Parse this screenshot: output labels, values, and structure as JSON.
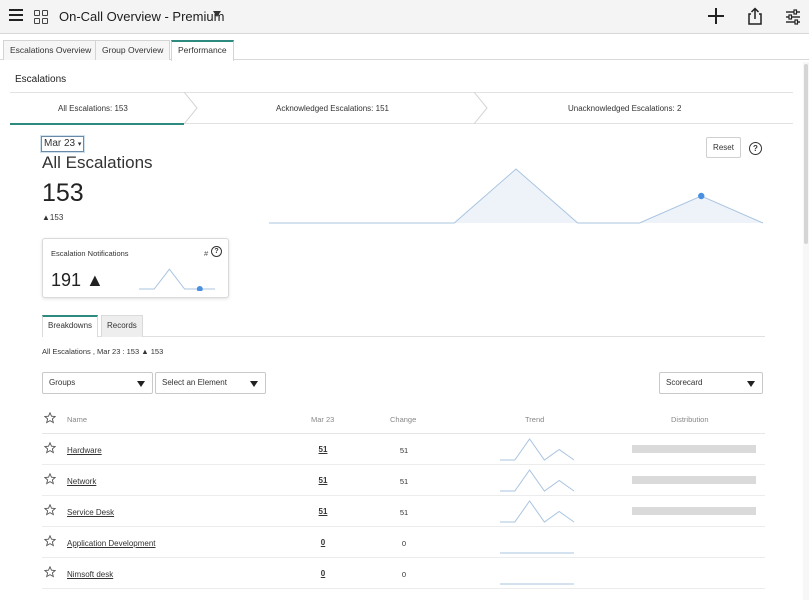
{
  "topbar": {
    "title": "On-Call Overview - Premium",
    "icons": [
      "menu-icon",
      "grid-icon",
      "chevron-down-icon",
      "plus-icon",
      "share-icon",
      "filter-icon"
    ]
  },
  "tabs": [
    {
      "label": "Escalations Overview",
      "active": false
    },
    {
      "label": "Group Overview",
      "active": false
    },
    {
      "label": "Performance",
      "active": true
    }
  ],
  "section": {
    "title": "Escalations",
    "steps": [
      {
        "label": "All Escalations: 153",
        "active": true
      },
      {
        "label": "Acknowledged Escalations: 151",
        "active": false
      },
      {
        "label": "Unacknowledged Escalations: 2",
        "active": false
      }
    ]
  },
  "kpi": {
    "date_select": "Mar 23",
    "title": "All Escalations",
    "value": "153",
    "delta": "▲153",
    "reset_label": "Reset",
    "trend_series": [
      0,
      0,
      0,
      0,
      1,
      0,
      0,
      0.5,
      0
    ]
  },
  "card": {
    "title": "Escalation Notifications",
    "hash": "#",
    "value": "191 ▲",
    "spark_series": [
      0,
      0,
      0.9,
      0,
      0,
      0
    ]
  },
  "subtabs": [
    {
      "label": "Breakdowns",
      "active": true
    },
    {
      "label": "Records",
      "active": false
    }
  ],
  "summary": "All Escalations , Mar 23 : 153 ▲ 153",
  "filters": {
    "groups": "Groups",
    "element": "Select an Element",
    "view": "Scorecard"
  },
  "table": {
    "columns": [
      "Name",
      "Mar 23",
      "Change",
      "Trend",
      "Distribution"
    ],
    "rows": [
      {
        "name": "Hardware",
        "value": "51",
        "change": "51",
        "trend": [
          0,
          0,
          1,
          0,
          0.5,
          0
        ],
        "distribution": 1
      },
      {
        "name": "Network",
        "value": "51",
        "change": "51",
        "trend": [
          0,
          0,
          1,
          0,
          0.5,
          0
        ],
        "distribution": 1
      },
      {
        "name": "Service Desk",
        "value": "51",
        "change": "51",
        "trend": [
          0,
          0,
          1,
          0,
          0.5,
          0
        ],
        "distribution": 1
      },
      {
        "name": "Application Development",
        "value": "0",
        "change": "0",
        "trend": [
          0,
          0,
          0,
          0,
          0,
          0
        ],
        "distribution": 0
      },
      {
        "name": "Nimsoft desk",
        "value": "0",
        "change": "0",
        "trend": [
          0,
          0,
          0,
          0,
          0,
          0
        ],
        "distribution": 0
      }
    ]
  },
  "colors": {
    "accent": "#2d8a7e",
    "spark_line": "#a9c4e0",
    "spark_fill": "#eef3f9",
    "point": "#4a90e2",
    "distribution_bar": "#dadada"
  }
}
